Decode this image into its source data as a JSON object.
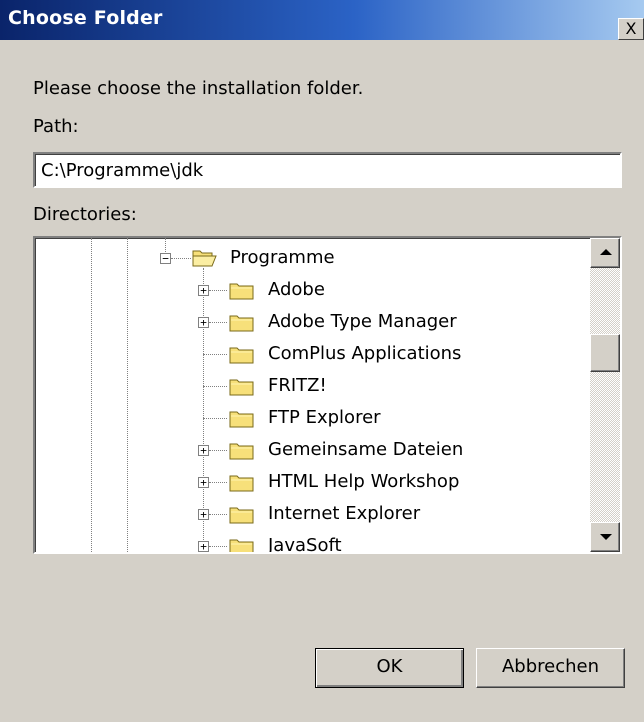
{
  "window": {
    "title": "Choose Folder",
    "close_label": "X"
  },
  "dialog": {
    "prompt": "Please choose the installation folder.",
    "path_label": "Path:",
    "path_value": "C:\\Programme\\jdk",
    "directories_label": "Directories:"
  },
  "tree": {
    "items": [
      {
        "label": "Programme",
        "expander": "−",
        "icon": "folder-open-icon"
      },
      {
        "label": "Adobe",
        "expander": "+",
        "icon": "folder-icon"
      },
      {
        "label": "Adobe Type Manager",
        "expander": "+",
        "icon": "folder-icon"
      },
      {
        "label": "ComPlus Applications",
        "expander": "",
        "icon": "folder-icon"
      },
      {
        "label": "FRITZ!",
        "expander": "",
        "icon": "folder-icon"
      },
      {
        "label": "FTP Explorer",
        "expander": "",
        "icon": "folder-icon"
      },
      {
        "label": "Gemeinsame Dateien",
        "expander": "+",
        "icon": "folder-icon"
      },
      {
        "label": "HTML Help Workshop",
        "expander": "+",
        "icon": "folder-icon"
      },
      {
        "label": "Internet Explorer",
        "expander": "+",
        "icon": "folder-icon"
      },
      {
        "label": "JavaSoft",
        "expander": "+",
        "icon": "folder-icon"
      }
    ]
  },
  "buttons": {
    "ok_label": "OK",
    "cancel_label": "Abbrechen"
  },
  "colors": {
    "title_bar_start": "#0a246a",
    "title_bar_end": "#a6caf0",
    "dialog_background": "#d4d0c8",
    "folder_yellow": "#f7e07a"
  }
}
